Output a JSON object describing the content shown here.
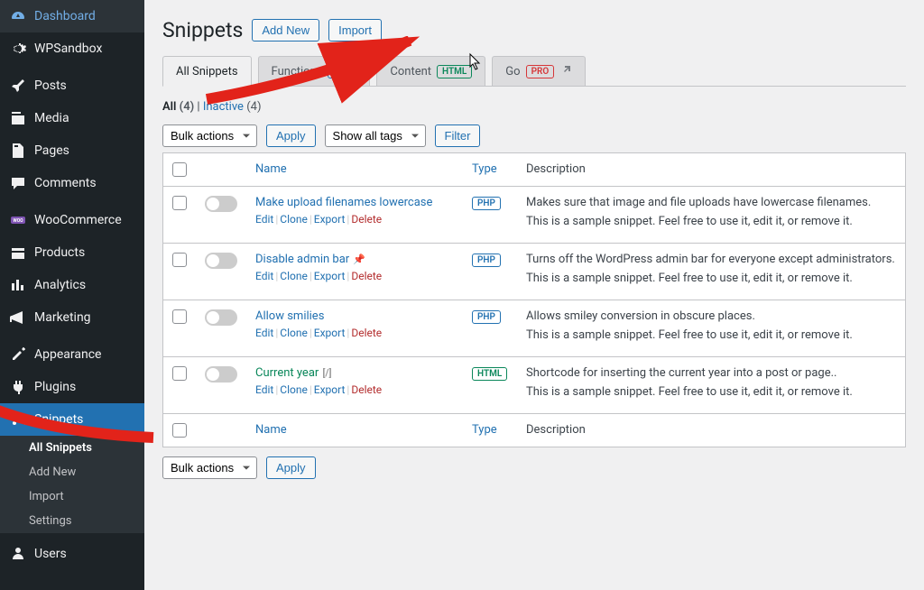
{
  "sidebar": {
    "items": [
      {
        "label": "Dashboard",
        "icon": "dashboard"
      },
      {
        "label": "WPSandbox",
        "icon": "gear"
      },
      {
        "label": "Posts",
        "icon": "pin"
      },
      {
        "label": "Media",
        "icon": "media"
      },
      {
        "label": "Pages",
        "icon": "page"
      },
      {
        "label": "Comments",
        "icon": "comment"
      },
      {
        "label": "WooCommerce",
        "icon": "woo"
      },
      {
        "label": "Products",
        "icon": "products"
      },
      {
        "label": "Analytics",
        "icon": "analytics"
      },
      {
        "label": "Marketing",
        "icon": "marketing"
      },
      {
        "label": "Appearance",
        "icon": "appearance"
      },
      {
        "label": "Plugins",
        "icon": "plugin"
      },
      {
        "label": "Snippets",
        "icon": "scissors",
        "active": true
      },
      {
        "label": "Users",
        "icon": "user"
      }
    ],
    "submenu": [
      {
        "label": "All Snippets",
        "active": true
      },
      {
        "label": "Add New"
      },
      {
        "label": "Import"
      },
      {
        "label": "Settings"
      }
    ]
  },
  "header": {
    "title": "Snippets",
    "add_new": "Add New",
    "import": "Import"
  },
  "tabs": [
    {
      "label": "All Snippets",
      "active": true
    },
    {
      "label": "Functions",
      "badge": "PHP",
      "badgeClass": "badge-php"
    },
    {
      "label": "Content",
      "badge": "HTML",
      "badgeClass": "badge-html"
    },
    {
      "label": "Go",
      "badge": "PRO",
      "badgeClass": "badge-pro",
      "external": true
    }
  ],
  "subsubsub": {
    "all_label": "All",
    "all_count": "(4)",
    "inactive_label": "Inactive",
    "inactive_count": "(4)"
  },
  "tablenav": {
    "bulk": "Bulk actions",
    "apply": "Apply",
    "tags": "Show all tags",
    "filter": "Filter"
  },
  "table": {
    "headers": {
      "name": "Name",
      "type": "Type",
      "desc": "Description"
    },
    "row_actions": {
      "edit": "Edit",
      "clone": "Clone",
      "export": "Export",
      "delete": "Delete"
    },
    "rows": [
      {
        "name": "Make upload filenames lowercase",
        "type": "PHP",
        "badgeClass": "badge-php",
        "desc1": "Makes sure that image and file uploads have lowercase filenames.",
        "desc2": "This is a sample snippet. Feel free to use it, edit it, or remove it."
      },
      {
        "name": "Disable admin bar",
        "pin": true,
        "type": "PHP",
        "badgeClass": "badge-php",
        "desc1": "Turns off the WordPress admin bar for everyone except administrators.",
        "desc2": "This is a sample snippet. Feel free to use it, edit it, or remove it."
      },
      {
        "name": "Allow smilies",
        "type": "PHP",
        "badgeClass": "badge-php",
        "desc1": "Allows smiley conversion in obscure places.",
        "desc2": "This is a sample snippet. Feel free to use it, edit it, or remove it."
      },
      {
        "name": "Current year",
        "shortcode": true,
        "green": true,
        "type": "HTML",
        "badgeClass": "badge-html",
        "desc1": "Shortcode for inserting the current year into a post or page..",
        "desc2": "This is a sample snippet. Feel free to use it, edit it, or remove it."
      }
    ]
  }
}
